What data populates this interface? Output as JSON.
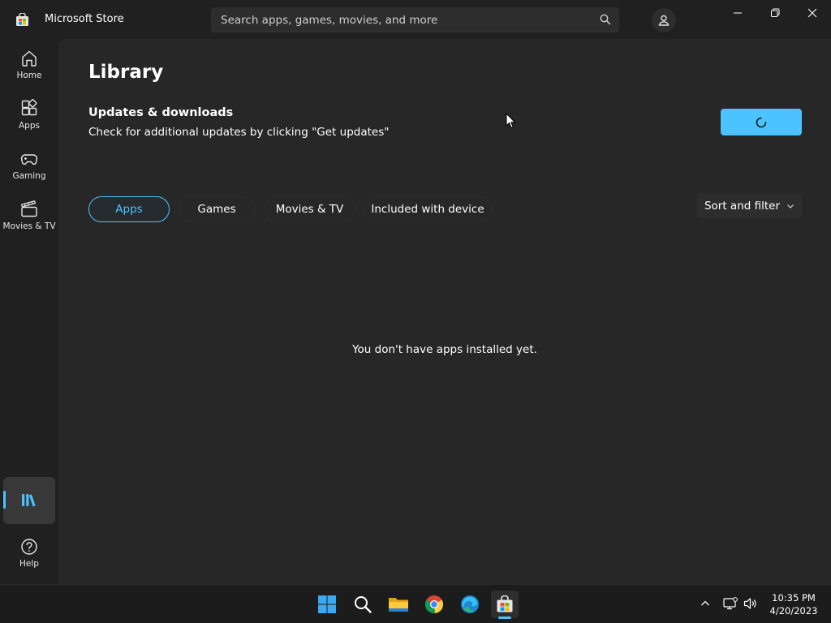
{
  "window": {
    "title": "Microsoft Store"
  },
  "search": {
    "placeholder": "Search apps, games, movies, and more"
  },
  "sidebar": {
    "items": [
      {
        "label": "Home",
        "icon": "home-icon"
      },
      {
        "label": "Apps",
        "icon": "apps-icon"
      },
      {
        "label": "Gaming",
        "icon": "gaming-icon"
      },
      {
        "label": "Movies & TV",
        "icon": "movies-tv-icon"
      }
    ],
    "library_icon": "library-icon",
    "help": {
      "label": "Help",
      "icon": "help-icon"
    }
  },
  "main": {
    "page_title": "Library",
    "section_title": "Updates & downloads",
    "section_subtitle": "Check for additional updates by clicking \"Get updates\"",
    "get_updates_state": "loading",
    "tabs": [
      {
        "label": "Apps",
        "selected": true
      },
      {
        "label": "Games",
        "selected": false
      },
      {
        "label": "Movies & TV",
        "selected": false
      },
      {
        "label": "Included with device",
        "selected": false
      }
    ],
    "sort_filter_label": "Sort and filter",
    "empty_message": "You don't have apps installed yet."
  },
  "taskbar": {
    "pinned": [
      "windows-start-icon",
      "search-icon",
      "file-explorer-icon",
      "chrome-icon",
      "edge-icon",
      "microsoft-store-icon"
    ],
    "time": "10:35 PM",
    "date": "4/20/2023"
  },
  "colors": {
    "accent": "#4cc2ff",
    "background": "#202020",
    "content": "#272727"
  }
}
